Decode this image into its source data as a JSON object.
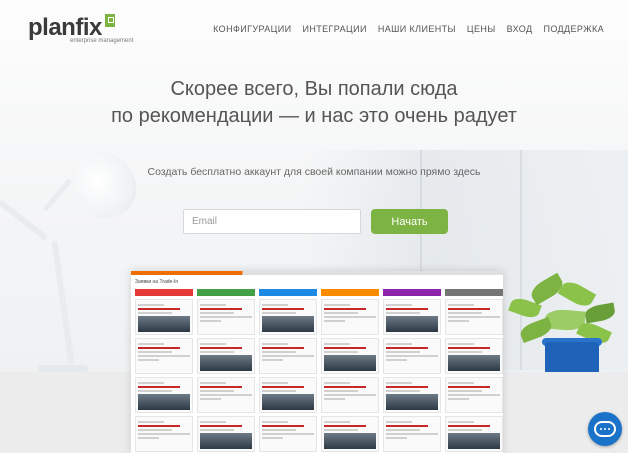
{
  "brand": {
    "name": "planfix",
    "tagline": "enterprise management",
    "accent_color": "#7cb342"
  },
  "nav": {
    "items": [
      {
        "label": "КОНФИГУРАЦИИ"
      },
      {
        "label": "ИНТЕГРАЦИИ"
      },
      {
        "label": "НАШИ КЛИЕНТЫ"
      },
      {
        "label": "ЦЕНЫ"
      },
      {
        "label": "ВХОД"
      },
      {
        "label": "ПОДДЕРЖКА"
      }
    ]
  },
  "hero": {
    "headline_line1": "Скорее всего, Вы попали сюда",
    "headline_line2": "по рекомендации — и нас это очень радует",
    "subtitle": "Создать бесплатно аккаунт для своей компании можно прямо здесь",
    "email_placeholder": "Email",
    "start_button_label": "Начать",
    "button_color": "#7cb342"
  },
  "preview": {
    "board_title": "Заявки на Trade-In",
    "columns": [
      {
        "color": "#e53935"
      },
      {
        "color": "#43a047"
      },
      {
        "color": "#1e88e5"
      },
      {
        "color": "#fb8c00"
      },
      {
        "color": "#8e24aa"
      },
      {
        "color": "#757575"
      }
    ]
  },
  "chat": {
    "icon": "chat-bubble-icon",
    "color": "#1a73c9"
  }
}
